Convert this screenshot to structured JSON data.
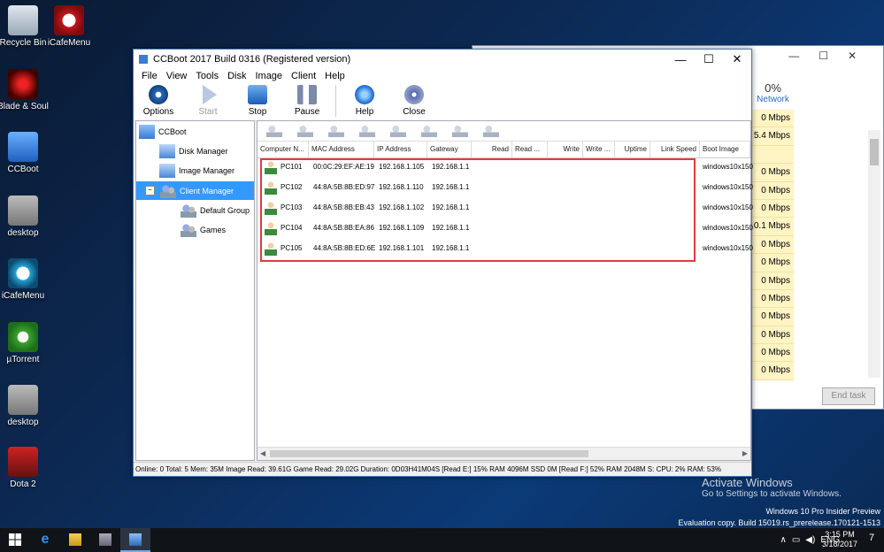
{
  "desktop": {
    "icons": [
      {
        "label": "Recycle Bin",
        "icon": "recycle-bin-icon"
      },
      {
        "label": "iCafeMenu",
        "icon": "icafemenu-icon"
      },
      {
        "label": "Blade & Soul",
        "icon": "blade-soul-icon"
      },
      {
        "label": "CCBoot",
        "icon": "ccboot-icon"
      },
      {
        "label": "desktop",
        "icon": "file-icon"
      },
      {
        "label": "iCafeMenu",
        "icon": "icafemenu-icon"
      },
      {
        "label": "µTorrent",
        "icon": "utorrent-icon"
      },
      {
        "label": "desktop",
        "icon": "file-icon"
      },
      {
        "label": "Dota 2",
        "icon": "dota2-icon"
      }
    ]
  },
  "taskmgr": {
    "net_pct": "0%",
    "net_label": "Network",
    "values": [
      "0 Mbps",
      "5.4 Mbps",
      "",
      "0 Mbps",
      "0 Mbps",
      "0 Mbps",
      "0.1 Mbps",
      "0 Mbps",
      "0 Mbps",
      "0 Mbps",
      "0 Mbps",
      "0 Mbps",
      "0 Mbps",
      "0 Mbps",
      "0 Mbps"
    ],
    "end_task": "End task"
  },
  "window": {
    "title": "CCBoot 2017 Build 0316 (Registered version)",
    "menu": [
      "File",
      "View",
      "Tools",
      "Disk",
      "Image",
      "Client",
      "Help"
    ],
    "toolbar": {
      "options": "Options",
      "start": "Start",
      "stop": "Stop",
      "pause": "Pause",
      "help": "Help",
      "close": "Close"
    },
    "tree": {
      "root": "CCBoot",
      "disk_manager": "Disk Manager",
      "image_manager": "Image Manager",
      "client_manager": "Client Manager",
      "default_group": "Default Group",
      "games": "Games",
      "expander": "−"
    },
    "columns": [
      "Computer N...",
      "MAC Address",
      "IP Address",
      "Gateway",
      "Read",
      "Read ...",
      "Write",
      "Write ...",
      "Uptime",
      "Link Speed",
      "Boot Image"
    ],
    "clients": [
      {
        "name": "PC101",
        "mac": "00:0C:29:EF:AE:19",
        "ip": "192.168.1.105",
        "gw": "192.168.1.1",
        "boot": "windows10x150"
      },
      {
        "name": "PC102",
        "mac": "44:8A:5B:8B:ED:97",
        "ip": "192.168.1.110",
        "gw": "192.168.1.1",
        "boot": "windows10x150"
      },
      {
        "name": "PC103",
        "mac": "44:8A:5B:8B:EB:43",
        "ip": "192.168.1.102",
        "gw": "192.168.1.1",
        "boot": "windows10x150"
      },
      {
        "name": "PC104",
        "mac": "44:8A:5B:8B:EA:86",
        "ip": "192.168.1.109",
        "gw": "192.168.1.1",
        "boot": "windows10x150"
      },
      {
        "name": "PC105",
        "mac": "44:8A:5B:8B:ED:6E",
        "ip": "192.168.1.101",
        "gw": "192.168.1.1",
        "boot": "windows10x150"
      }
    ],
    "status": "Online: 0 Total: 5 Mem: 35M Image Read: 39.61G Game Read: 29.02G Duration: 0D03H41M04S [Read E:] 15% RAM 4096M SSD 0M [Read F:] 52% RAM 2048M S: CPU: 2% RAM: 53%"
  },
  "watermark": {
    "line1": "Activate Windows",
    "line2": "Go to Settings to activate Windows."
  },
  "build_info": {
    "line1": "Windows 10 Pro Insider Preview",
    "line2": "Evaluation copy. Build 15019.rs_prerelease.170121-1513"
  },
  "taskbar": {
    "time": "3:15 PM",
    "date": "3/18/2017",
    "notif_count": "7"
  }
}
